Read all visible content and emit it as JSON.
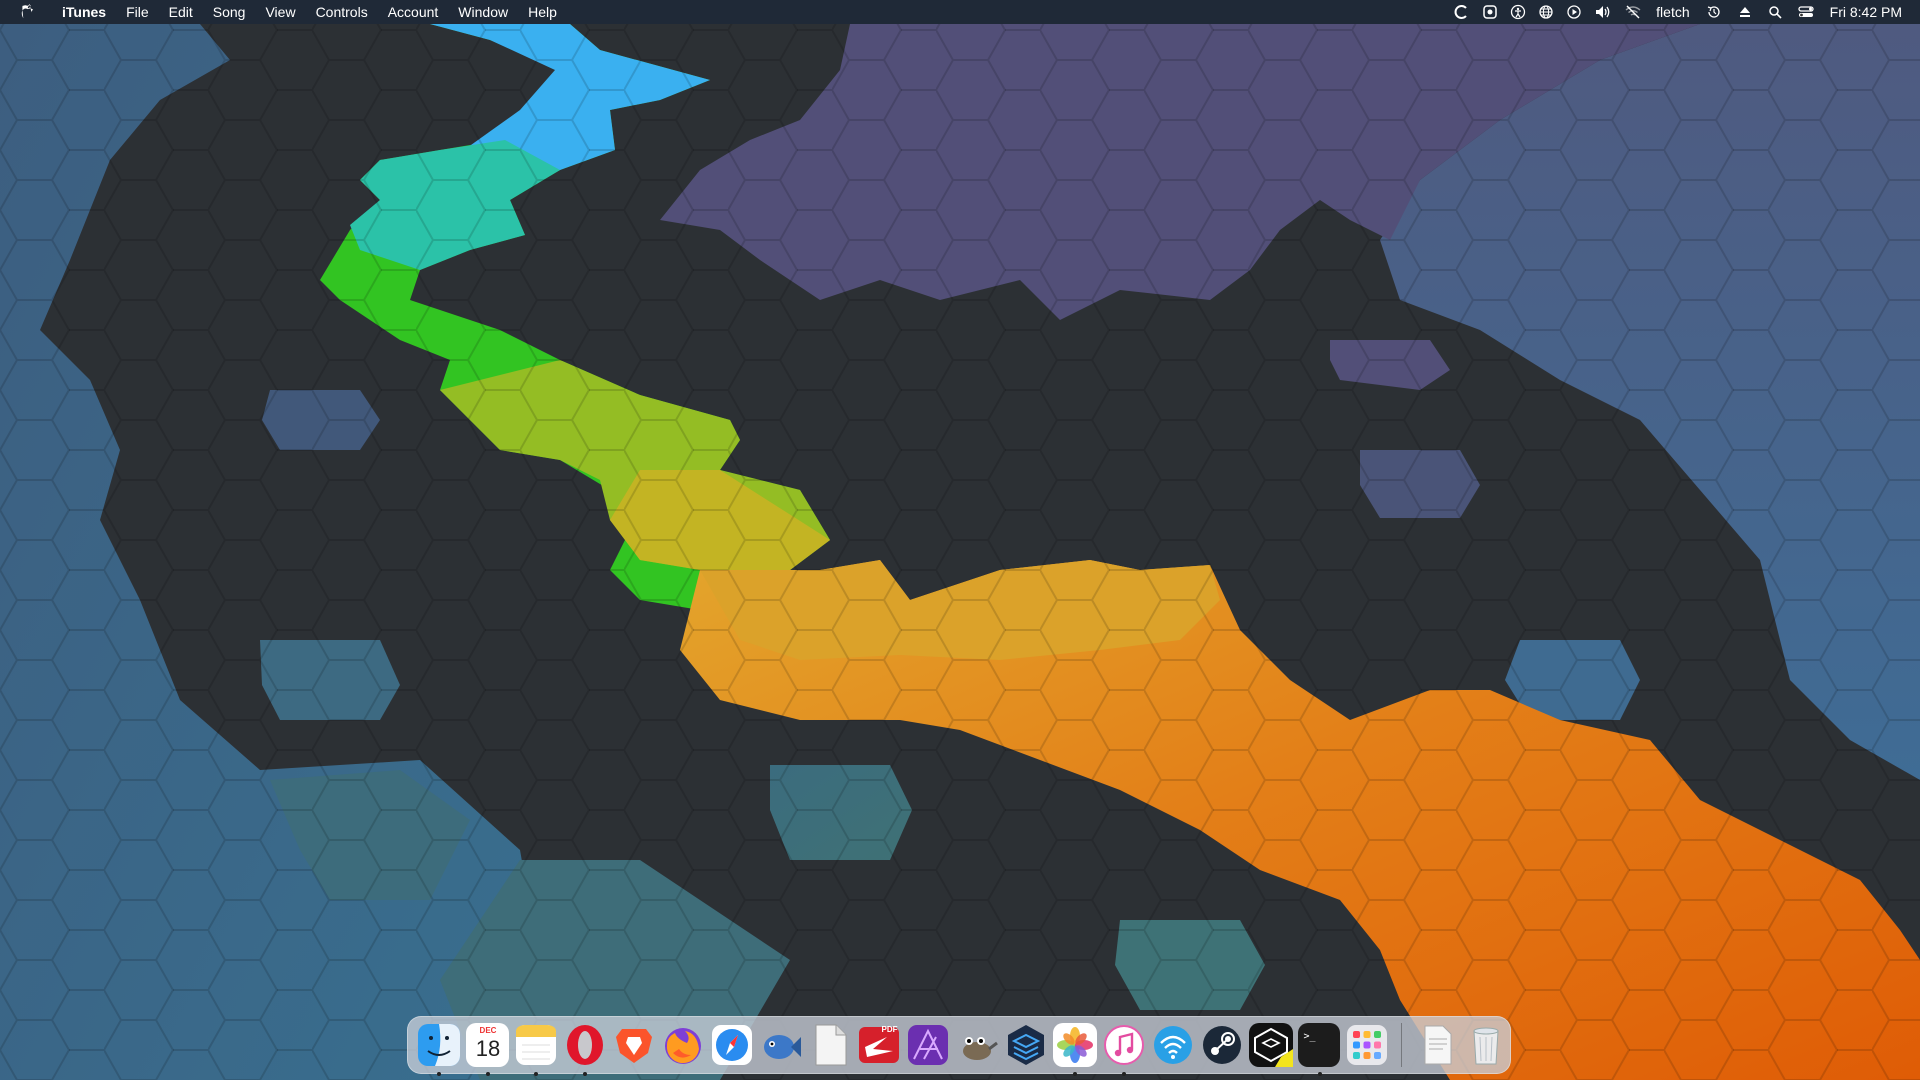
{
  "menubar": {
    "apple_icon": "apple-logo-icon",
    "app_name": "iTunes",
    "menus": [
      "File",
      "Edit",
      "Song",
      "View",
      "Controls",
      "Account",
      "Window",
      "Help"
    ],
    "status_icons": [
      "c-app-icon",
      "display-icon",
      "accessibility-icon",
      "globe-icon",
      "play-circle-icon",
      "volume-icon",
      "wifi-off-icon"
    ],
    "user": "fletch",
    "extra_icons": [
      "time-machine-icon",
      "eject-icon",
      "spotlight-search-icon",
      "control-center-icon"
    ],
    "clock": "Fri 8:42 PM"
  },
  "dock": {
    "calendar": {
      "month": "DEC",
      "day": "18"
    },
    "pdf_badge": "PDF",
    "terminal_prompt": ">_",
    "items": [
      {
        "name": "finder-icon",
        "running": true
      },
      {
        "name": "calendar-icon",
        "running": true
      },
      {
        "name": "notes-icon",
        "running": true
      },
      {
        "name": "opera-icon",
        "running": true
      },
      {
        "name": "brave-icon",
        "running": false
      },
      {
        "name": "firefox-icon",
        "running": false
      },
      {
        "name": "safari-icon",
        "running": false
      },
      {
        "name": "fish-app-icon",
        "running": false
      },
      {
        "name": "blank-document-icon",
        "running": false
      },
      {
        "name": "pdf-app-icon",
        "running": false
      },
      {
        "name": "affinity-photo-icon",
        "running": false
      },
      {
        "name": "gimp-icon",
        "running": false
      },
      {
        "name": "layers-app-icon",
        "running": false
      },
      {
        "name": "photos-icon",
        "running": true
      },
      {
        "name": "itunes-icon",
        "running": true
      },
      {
        "name": "wifi-app-icon",
        "running": false
      },
      {
        "name": "steam-icon",
        "running": false
      },
      {
        "name": "cube-app-icon",
        "running": false
      },
      {
        "name": "terminal-icon",
        "running": true
      },
      {
        "name": "launchpad-icon",
        "running": false
      },
      {
        "name": "pdf-document-icon",
        "running": false
      },
      {
        "name": "trash-icon",
        "running": false
      }
    ]
  },
  "wallpaper": {
    "colors": {
      "base": "#2c3034",
      "blue": "#3a6a8e",
      "purple": "#524f78",
      "teal": "#3d6e77",
      "orange": "#e0650c",
      "amber": "#dba22a",
      "green": "#33c21f",
      "cyan": "#3ab0f0"
    }
  }
}
